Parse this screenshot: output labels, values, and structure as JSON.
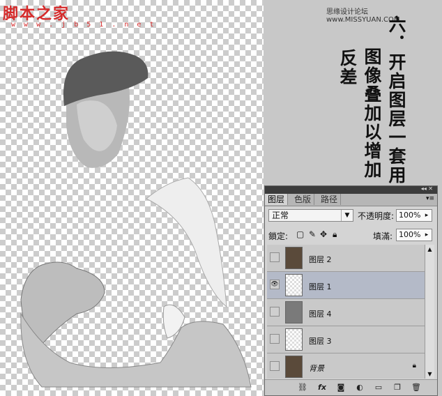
{
  "watermark": {
    "logo": "脚本之家",
    "url": "w w w . j b 5 1 . n e t",
    "right": "思缘设计论坛 www.MISSYUAN.COM"
  },
  "instruction": {
    "col1": "六．开启图层一套用",
    "col2": "图像叠加以增加",
    "col3": "反差"
  },
  "layers_panel": {
    "tabs": [
      "图层",
      "色版",
      "路径"
    ],
    "blend_mode": "正常",
    "opacity_label": "不透明度:",
    "opacity_value": "100%",
    "lock_label": "鎖定:",
    "fill_label": "填滿:",
    "fill_value": "100%",
    "layers": [
      {
        "name": "图层 2",
        "visible": false,
        "selected": false
      },
      {
        "name": "图层 1",
        "visible": true,
        "selected": true
      },
      {
        "name": "图层 4",
        "visible": false,
        "selected": false
      },
      {
        "name": "图层 3",
        "visible": false,
        "selected": false
      },
      {
        "name": "背景",
        "visible": false,
        "selected": false
      }
    ],
    "footer_icons": [
      "link-icon",
      "fx-icon",
      "mask-icon",
      "adjustment-icon",
      "folder-icon",
      "new-layer-icon",
      "trash-icon"
    ]
  },
  "colors": {
    "watermark_red": "#d52a2a",
    "selected_layer": "#b4bac8",
    "panel_bg": "#d4d4d4"
  }
}
